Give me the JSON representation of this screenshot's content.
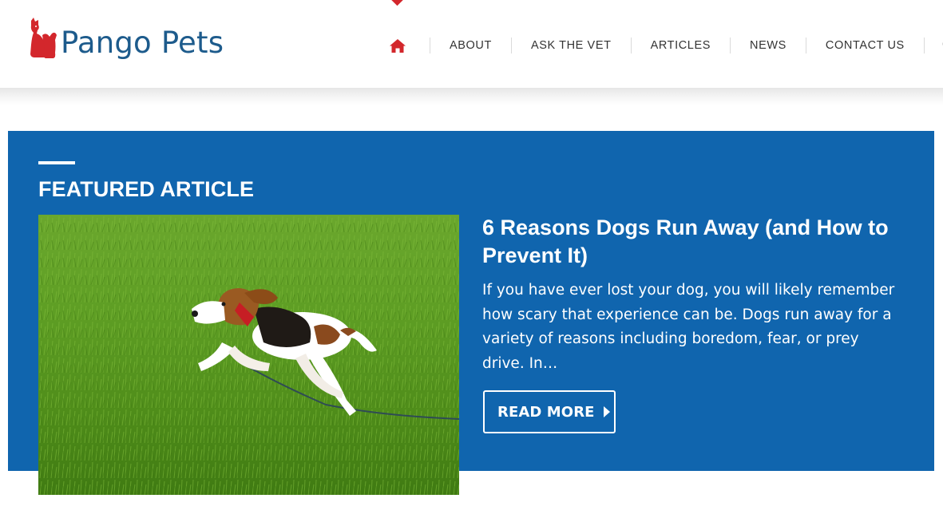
{
  "site": {
    "name": "Pango Pets",
    "brand_color": "#1d5b8c",
    "accent_color": "#d3272c",
    "logo_icon": "cat-dog-silhouette-icon"
  },
  "nav": {
    "home_icon": "home-icon",
    "items": [
      {
        "label": "ABOUT"
      },
      {
        "label": "ASK THE VET"
      },
      {
        "label": "ARTICLES"
      },
      {
        "label": "NEWS"
      },
      {
        "label": "CONTACT US"
      }
    ],
    "search_icon": "search-icon"
  },
  "featured": {
    "heading": "FEATURED ARTICLE",
    "background_color": "#1065ae",
    "article": {
      "title": "6 Reasons Dogs Run Away (and How to Prevent It)",
      "excerpt": "If you have ever lost your dog, you will likely remember how scary that experience can be. Dogs run away for a variety of reasons including boredom, fear, or prey drive. In…",
      "read_more_label": "READ MORE",
      "read_more_icon": "caret-right-icon",
      "image_subject": "beagle running on grass"
    }
  }
}
